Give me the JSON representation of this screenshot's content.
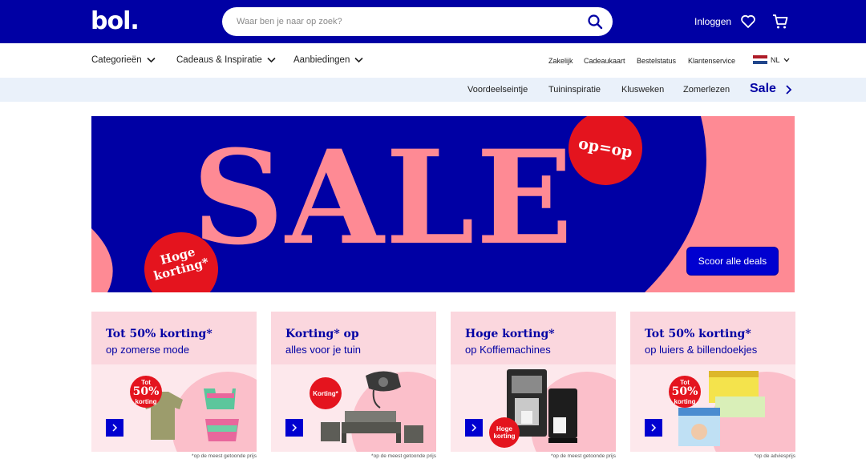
{
  "header": {
    "logo": "bol.",
    "search_placeholder": "Waar ben je naar op zoek?",
    "login_label": "Inloggen",
    "brand_color": "#0000a4"
  },
  "nav": {
    "categories": "Categorieën",
    "gifts": "Cadeaus & Inspiratie",
    "offers": "Aanbiedingen",
    "business": "Zakelijk",
    "giftcard": "Cadeaukaart",
    "order_status": "Bestelstatus",
    "customer_service": "Klantenservice",
    "language": "NL"
  },
  "subnav": {
    "items": [
      "Voordeelseintje",
      "Tuininspiratie",
      "Klusweken",
      "Zomerlezen"
    ],
    "sale": "Sale"
  },
  "hero": {
    "headline": "SALE",
    "badge_top": "op=op",
    "badge_bottom_line1": "Hoge",
    "badge_bottom_line2": "korting*",
    "cta": "Scoor alle deals"
  },
  "cards": [
    {
      "title": "Tot 50% korting*",
      "subtitle": "op zomerse mode",
      "badge_small_top": "Tot",
      "badge_big": "50%",
      "badge_small_bottom": "korting",
      "footnote": "*op de meest getoonde prijs",
      "icon": "clothing-icon"
    },
    {
      "title": "Korting* op",
      "subtitle": "alles voor je tuin",
      "badge_label": "Korting*",
      "footnote": "*op de meest getoonde prijs",
      "icon": "garden-furniture-icon"
    },
    {
      "title": "Hoge korting*",
      "subtitle": "op Koffiemachines",
      "badge_line1": "Hoge",
      "badge_line2": "korting",
      "footnote": "*op de meest getoonde prijs",
      "icon": "coffee-machine-icon"
    },
    {
      "title": "Tot 50% korting*",
      "subtitle": "op luiers & billendoekjes",
      "badge_small_top": "Tot",
      "badge_big": "50%",
      "badge_small_bottom": "korting",
      "footnote": "*op de adviesprijs",
      "icon": "diapers-icon"
    }
  ]
}
